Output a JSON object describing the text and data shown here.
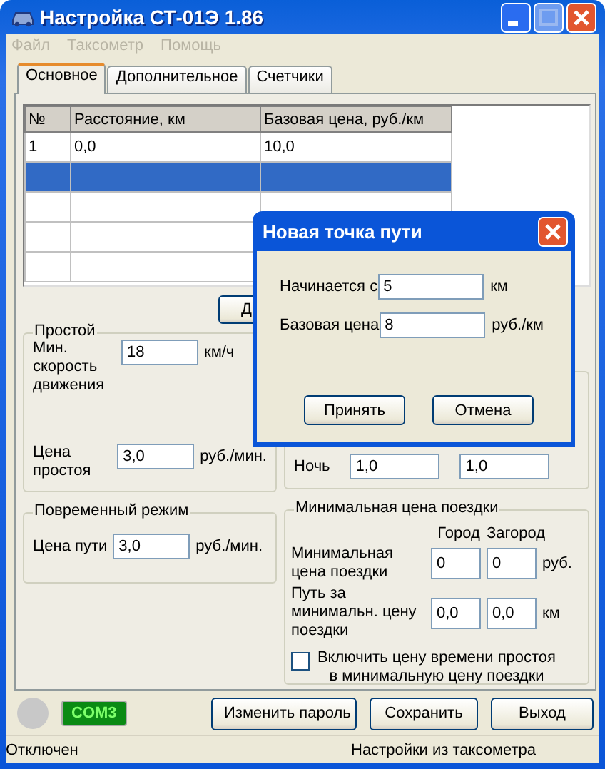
{
  "window": {
    "title": "Настройка СТ-01Э 1.86"
  },
  "menu": [
    {
      "label": "Файл",
      "disabled": true
    },
    {
      "label": "Таксометр",
      "disabled": true
    },
    {
      "label": "Помощь",
      "disabled": true
    }
  ],
  "tabs": [
    {
      "label": "Основное",
      "selected": true
    },
    {
      "label": "Дополнительное",
      "selected": false
    },
    {
      "label": "Счетчики",
      "selected": false
    }
  ],
  "table": {
    "columns": [
      "№",
      "Расстояние, км",
      "Базовая цена, руб./км"
    ],
    "rows": [
      {
        "cells": [
          "1",
          "0,0",
          "10,0"
        ],
        "selected": false
      },
      {
        "selected": true
      },
      {
        "selected": false
      },
      {
        "selected": false
      },
      {
        "selected": false
      }
    ]
  },
  "add_button": {
    "label": "Д"
  },
  "idle_group": {
    "title": "Простой",
    "fields": [
      {
        "label": "Мин. скорость движения",
        "value": "18",
        "unit": "км/ч"
      },
      {
        "label": "Цена простоя",
        "value": "3,0",
        "unit": "руб./мин."
      }
    ]
  },
  "night_row": {
    "label": "Ночь",
    "values": [
      "1,0",
      "1,0"
    ]
  },
  "time_group": {
    "title": "Повременный режим",
    "field": {
      "label": "Цена пути",
      "value": "3,0",
      "unit": "руб./мин."
    }
  },
  "min_fare_group": {
    "title": "Минимальная цена поездки",
    "columns": [
      "Город",
      "Загород"
    ],
    "rows": [
      {
        "label": "Минимальная цена поездки",
        "values": [
          "0",
          "0"
        ],
        "unit": "руб."
      },
      {
        "label": "Путь за минимальн. цену поездки",
        "values": [
          "0,0",
          "0,0"
        ],
        "unit": "км"
      }
    ],
    "checkbox": {
      "label": "Включить цену времени простоя в минимальную цену поездки",
      "checked": false
    }
  },
  "connection": {
    "connected": false,
    "port": "COM3"
  },
  "buttons": [
    "Изменить пароль",
    "Сохранить",
    "Выход"
  ],
  "status_bar": [
    "Отключен",
    "Настройки из таксометра"
  ],
  "dialog": {
    "title": "Новая точка пути",
    "fields": [
      {
        "label": "Начинается с",
        "value": "5",
        "unit": "км"
      },
      {
        "label": "Базовая цена",
        "value": "8",
        "unit": "руб./км"
      }
    ],
    "buttons": [
      "Принять",
      "Отмена"
    ]
  }
}
